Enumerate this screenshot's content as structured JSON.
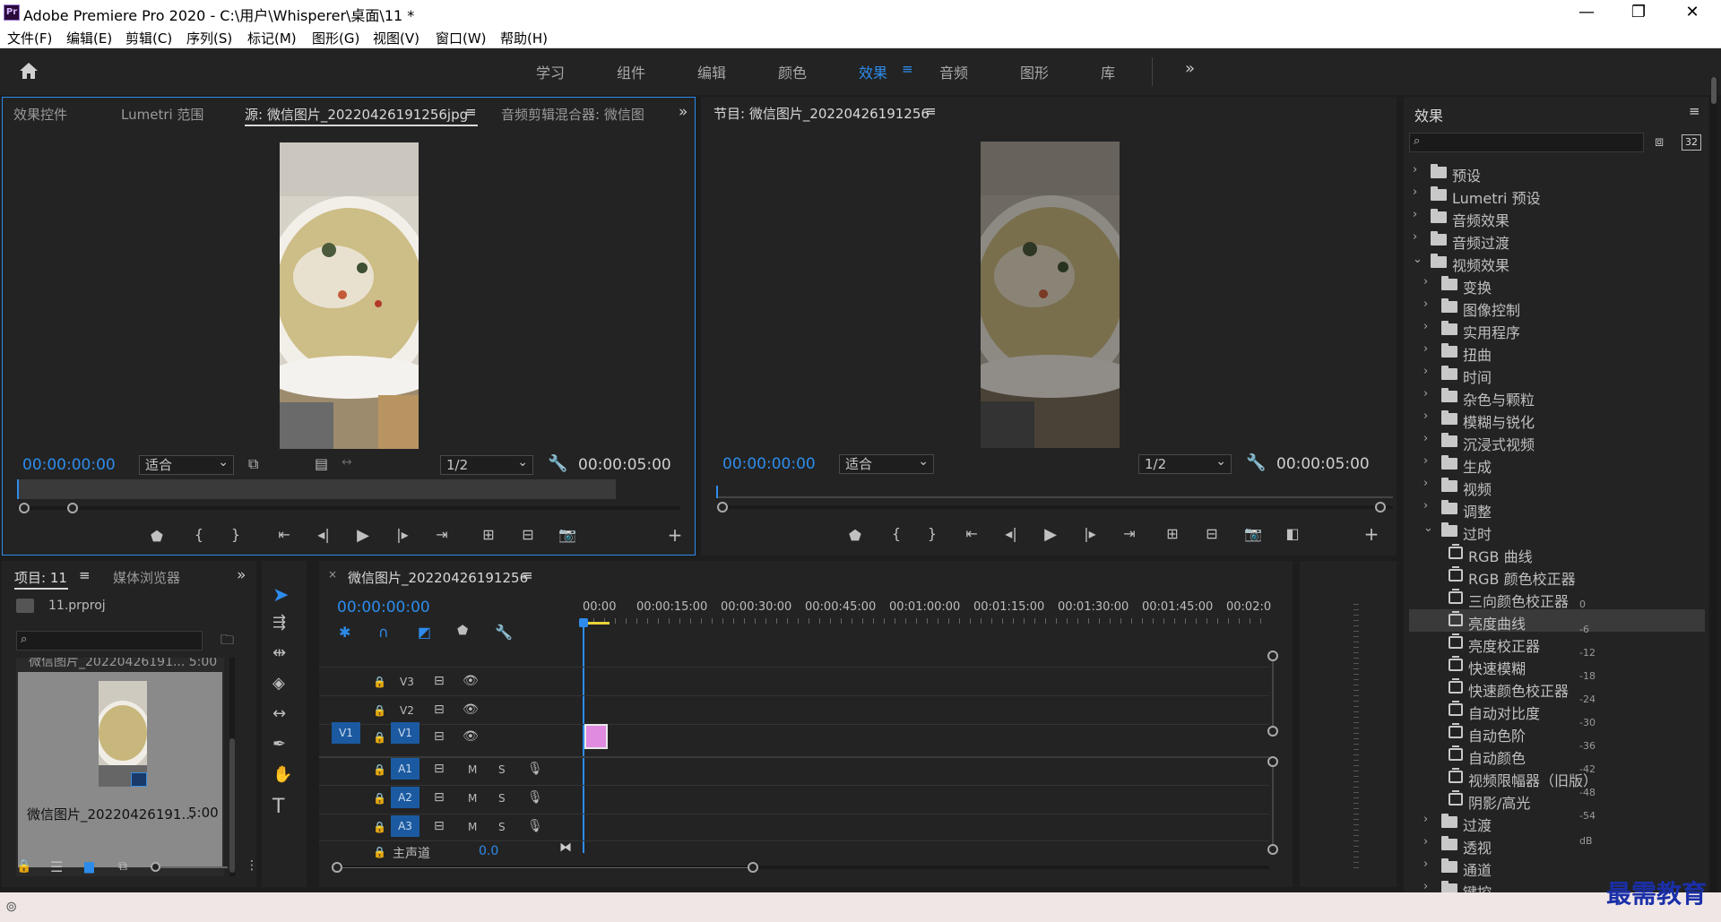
{
  "window": {
    "title": "Adobe Premiere Pro 2020 - C:\\用户\\Whisperer\\桌面\\11 *",
    "logo": "Pr"
  },
  "menu": [
    "文件(F)",
    "编辑(E)",
    "剪辑(C)",
    "序列(S)",
    "标记(M)",
    "图形(G)",
    "视图(V)",
    "窗口(W)",
    "帮助(H)"
  ],
  "workspaces": {
    "items": [
      "学习",
      "组件",
      "编辑",
      "颜色",
      "效果",
      "音频",
      "图形",
      "库"
    ],
    "active": "效果"
  },
  "source_panel": {
    "tabs": [
      "效果控件",
      "Lumetri 范围",
      "源: 微信图片_20220426191256jpg",
      "音频剪辑混合器: 微信图"
    ],
    "timecode_in": "00:00:00:00",
    "fit": "适合",
    "resolution": "1/2",
    "timecode_out": "00:00:05:00"
  },
  "program_panel": {
    "title": "节目: 微信图片_20220426191256",
    "timecode_in": "00:00:00:00",
    "fit": "适合",
    "resolution": "1/2",
    "timecode_out": "00:00:05:00"
  },
  "project_panel": {
    "tabs": [
      "项目: 11",
      "媒体浏览器"
    ],
    "project_file": "11.prproj",
    "search_placeholder": "",
    "clip_partial": "微信图片_20220426191... 5:00",
    "clip_name": "微信图片_20220426191...",
    "clip_duration": "5:00"
  },
  "timeline": {
    "title": "微信图片_20220426191256",
    "timecode": "00:00:00:00",
    "ruler": [
      "00:00",
      "00:00:15:00",
      "00:00:30:00",
      "00:00:45:00",
      "00:01:00:00",
      "00:01:15:00",
      "00:01:30:00",
      "00:01:45:00",
      "00:02:0"
    ],
    "video_tracks": [
      "V3",
      "V2",
      "V1"
    ],
    "source_patch": "V1",
    "audio_tracks": [
      "A1",
      "A2",
      "A3"
    ],
    "m_label": "M",
    "s_label": "S",
    "master_label": "主声道",
    "master_value": "0.0"
  },
  "meter": {
    "labels": [
      "0",
      "-6",
      "-12",
      "-18",
      "-24",
      "-30",
      "-36",
      "-42",
      "-48",
      "-54"
    ],
    "unit": "dB"
  },
  "effects_panel": {
    "title": "效果",
    "badge_32": "32",
    "tree": [
      {
        "label": "预设",
        "level": 0,
        "kind": "folder-star",
        "open": false
      },
      {
        "label": "Lumetri 预设",
        "level": 0,
        "kind": "folder-star",
        "open": false
      },
      {
        "label": "音频效果",
        "level": 0,
        "kind": "folder",
        "open": false
      },
      {
        "label": "音频过渡",
        "level": 0,
        "kind": "folder",
        "open": false
      },
      {
        "label": "视频效果",
        "level": 0,
        "kind": "folder",
        "open": true
      },
      {
        "label": "变换",
        "level": 1,
        "kind": "folder",
        "open": false
      },
      {
        "label": "图像控制",
        "level": 1,
        "kind": "folder",
        "open": false
      },
      {
        "label": "实用程序",
        "level": 1,
        "kind": "folder",
        "open": false
      },
      {
        "label": "扭曲",
        "level": 1,
        "kind": "folder",
        "open": false
      },
      {
        "label": "时间",
        "level": 1,
        "kind": "folder",
        "open": false
      },
      {
        "label": "杂色与颗粒",
        "level": 1,
        "kind": "folder",
        "open": false
      },
      {
        "label": "模糊与锐化",
        "level": 1,
        "kind": "folder",
        "open": false
      },
      {
        "label": "沉浸式视频",
        "level": 1,
        "kind": "folder",
        "open": false
      },
      {
        "label": "生成",
        "level": 1,
        "kind": "folder",
        "open": false
      },
      {
        "label": "视频",
        "level": 1,
        "kind": "folder",
        "open": false
      },
      {
        "label": "调整",
        "level": 1,
        "kind": "folder",
        "open": false
      },
      {
        "label": "过时",
        "level": 1,
        "kind": "folder",
        "open": true
      },
      {
        "label": "RGB 曲线",
        "level": 2,
        "kind": "effect"
      },
      {
        "label": "RGB 颜色校正器",
        "level": 2,
        "kind": "effect"
      },
      {
        "label": "三向颜色校正器",
        "level": 2,
        "kind": "effect"
      },
      {
        "label": "亮度曲线",
        "level": 2,
        "kind": "effect",
        "selected": true
      },
      {
        "label": "亮度校正器",
        "level": 2,
        "kind": "effect"
      },
      {
        "label": "快速模糊",
        "level": 2,
        "kind": "effect"
      },
      {
        "label": "快速颜色校正器",
        "level": 2,
        "kind": "effect"
      },
      {
        "label": "自动对比度",
        "level": 2,
        "kind": "effect"
      },
      {
        "label": "自动色阶",
        "level": 2,
        "kind": "effect"
      },
      {
        "label": "自动颜色",
        "level": 2,
        "kind": "effect"
      },
      {
        "label": "视频限幅器（旧版）",
        "level": 2,
        "kind": "effect"
      },
      {
        "label": "阴影/高光",
        "level": 2,
        "kind": "effect"
      },
      {
        "label": "过渡",
        "level": 1,
        "kind": "folder",
        "open": false
      },
      {
        "label": "透视",
        "level": 1,
        "kind": "folder",
        "open": false
      },
      {
        "label": "通道",
        "level": 1,
        "kind": "folder",
        "open": false
      },
      {
        "label": "键控",
        "level": 1,
        "kind": "folder",
        "open": false
      }
    ]
  },
  "watermark": "最需教育",
  "colors": {
    "accent": "#2d8ceb",
    "panel_bg": "#232323",
    "app_bg": "#1d1d1d",
    "track_badge": "#1b5aa1",
    "clip": "#e08ae0",
    "playhead_in": "#e8d23a"
  }
}
